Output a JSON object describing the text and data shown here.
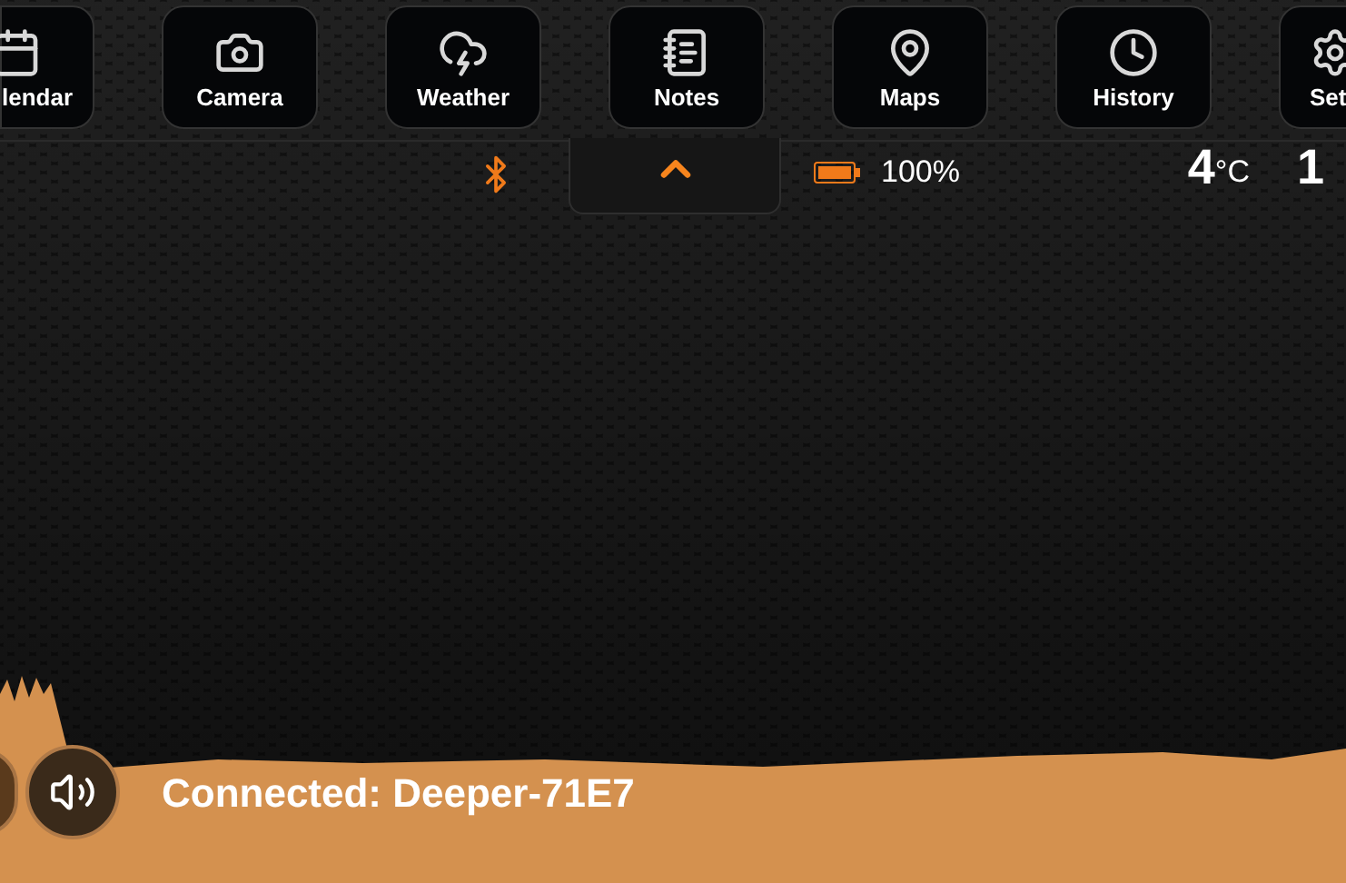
{
  "apps": [
    {
      "label": "lendar",
      "kind": "calendar"
    },
    {
      "label": "Camera",
      "kind": "camera"
    },
    {
      "label": "Weather",
      "kind": "weather"
    },
    {
      "label": "Notes",
      "kind": "notes"
    },
    {
      "label": "Maps",
      "kind": "maps"
    },
    {
      "label": "History",
      "kind": "history"
    },
    {
      "label": "Set",
      "kind": "settings"
    }
  ],
  "status": {
    "battery": "100%",
    "temperature": "4",
    "unit": "°C",
    "time": "1"
  },
  "footer": {
    "message": "Connected: Deeper-71E7"
  }
}
